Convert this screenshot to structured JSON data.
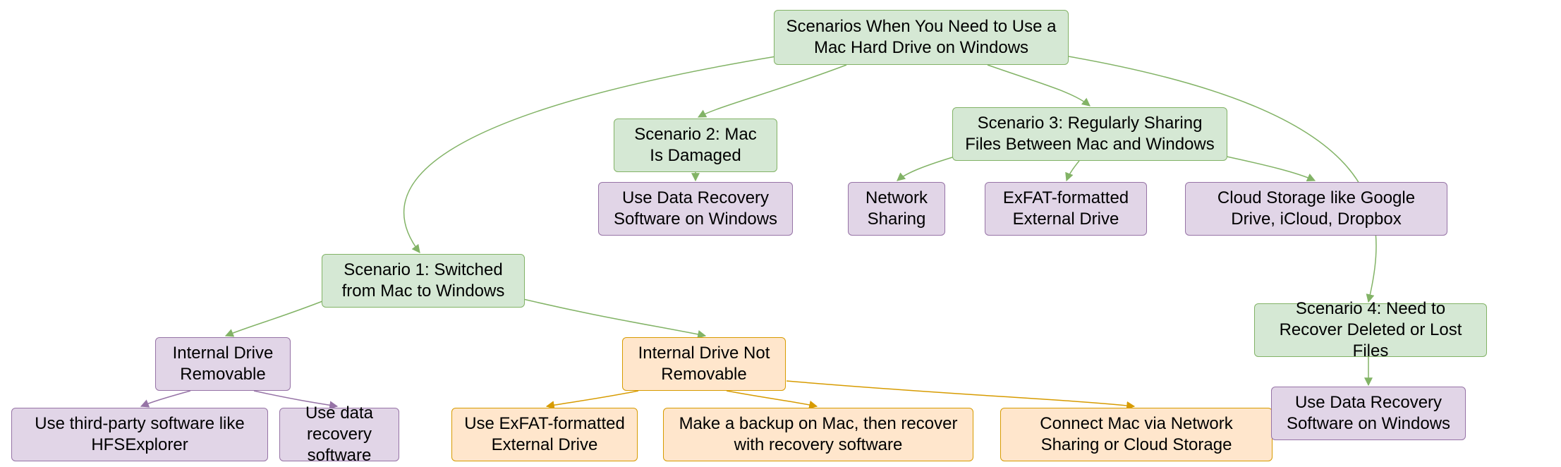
{
  "diagram": {
    "root": "Scenarios When You Need to Use a Mac Hard Drive on Windows",
    "scenario1": {
      "title": "Scenario 1: Switched from Mac to Windows",
      "removable": {
        "title": "Internal Drive Removable",
        "opt1": "Use third-party software like HFSExplorer",
        "opt2": "Use data recovery software"
      },
      "not_removable": {
        "title": "Internal Drive Not Removable",
        "opt1": "Use ExFAT-formatted External Drive",
        "opt2": "Make a backup on Mac, then recover with recovery software",
        "opt3": "Connect Mac via Network Sharing or Cloud Storage"
      }
    },
    "scenario2": {
      "title": "Scenario 2: Mac Is Damaged",
      "opt": "Use Data Recovery Software on Windows"
    },
    "scenario3": {
      "title": "Scenario 3: Regularly Sharing Files Between Mac and Windows",
      "opt1": "Network Sharing",
      "opt2": "ExFAT-formatted External Drive",
      "opt3": "Cloud Storage like Google Drive, iCloud, Dropbox"
    },
    "scenario4": {
      "title": "Scenario 4: Need to Recover Deleted or Lost Files",
      "opt": "Use Data Recovery Software on Windows"
    }
  }
}
